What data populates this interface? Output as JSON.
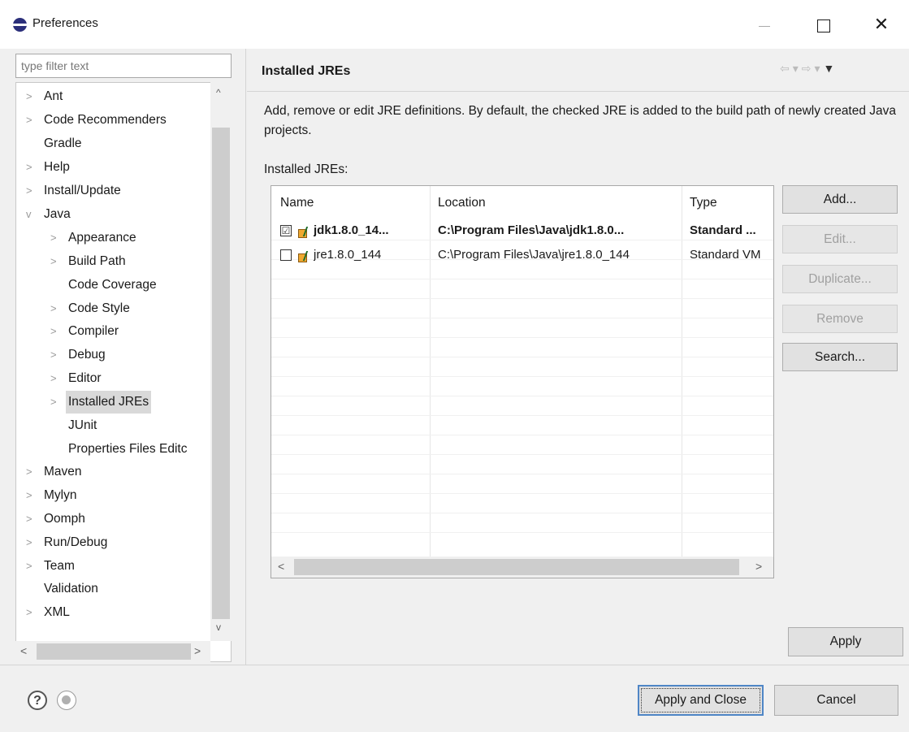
{
  "window": {
    "title": "Preferences",
    "minimize": "—",
    "maximize": "",
    "close": "✕"
  },
  "filter": {
    "placeholder": "type filter text"
  },
  "tree": {
    "items": [
      {
        "label": "Ant",
        "expander": ">"
      },
      {
        "label": "Code Recommenders",
        "expander": ">"
      },
      {
        "label": "Gradle",
        "expander": ""
      },
      {
        "label": "Help",
        "expander": ">"
      },
      {
        "label": "Install/Update",
        "expander": ">"
      },
      {
        "label": "Java",
        "expander": "v"
      },
      {
        "label": "Appearance",
        "expander": ">"
      },
      {
        "label": "Build Path",
        "expander": ">"
      },
      {
        "label": "Code Coverage",
        "expander": ""
      },
      {
        "label": "Code Style",
        "expander": ">"
      },
      {
        "label": "Compiler",
        "expander": ">"
      },
      {
        "label": "Debug",
        "expander": ">"
      },
      {
        "label": "Editor",
        "expander": ">"
      },
      {
        "label": "Installed JREs",
        "expander": ">"
      },
      {
        "label": "JUnit",
        "expander": ""
      },
      {
        "label": "Properties Files Editc",
        "expander": ""
      },
      {
        "label": "Maven",
        "expander": ">"
      },
      {
        "label": "Mylyn",
        "expander": ">"
      },
      {
        "label": "Oomph",
        "expander": ">"
      },
      {
        "label": "Run/Debug",
        "expander": ">"
      },
      {
        "label": "Team",
        "expander": ">"
      },
      {
        "label": "Validation",
        "expander": ""
      },
      {
        "label": "XML",
        "expander": ">"
      }
    ],
    "selected_index": 13,
    "scroll_up": "^",
    "scroll_down": "v",
    "scroll_left": "<",
    "scroll_right": ">"
  },
  "page": {
    "title": "Installed JREs",
    "nav_back": "⇦",
    "nav_back_menu": "▾",
    "nav_forward": "⇨",
    "nav_forward_menu": "▾",
    "view_menu": "▼",
    "description": "Add, remove or edit JRE definitions. By default, the checked JRE is added to the build path of newly created Java projects.",
    "list_label": "Installed JREs:"
  },
  "table": {
    "columns": [
      "Name",
      "Location",
      "Type"
    ],
    "rows": [
      {
        "checked": true,
        "check_mark": "☑",
        "name": "jdk1.8.0_14...",
        "location": "C:\\Program Files\\Java\\jdk1.8.0...",
        "type": "Standard ...",
        "bold": true
      },
      {
        "checked": false,
        "check_mark": "",
        "name": "jre1.8.0_144",
        "location": "C:\\Program Files\\Java\\jre1.8.0_144",
        "type": "Standard VM",
        "bold": false
      }
    ],
    "scroll_left": "<",
    "scroll_right": ">"
  },
  "buttons": {
    "add": "Add...",
    "edit": "Edit...",
    "duplicate": "Duplicate...",
    "remove": "Remove",
    "search": "Search...",
    "apply": "Apply",
    "apply_and_close": "Apply and Close",
    "cancel": "Cancel"
  },
  "footer": {
    "help": "?"
  }
}
